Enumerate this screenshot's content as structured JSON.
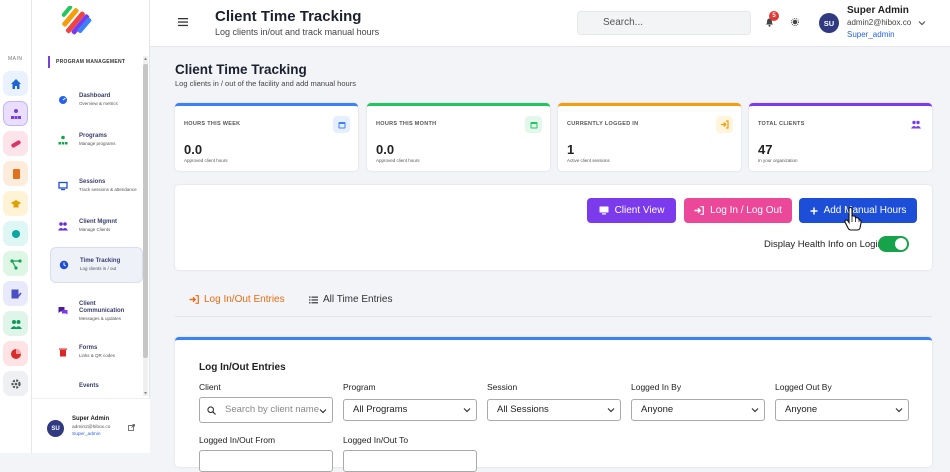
{
  "header": {
    "title": "Client Time Tracking",
    "subtitle": "Log clients in/out and track manual hours",
    "search_placeholder": "Search...",
    "notification_count": "5",
    "user_initials": "SU",
    "user_name": "Super Admin",
    "user_email": "admin2@hibox.co",
    "user_role": "Super_admin"
  },
  "rail": {
    "main_label": "MAIN",
    "icons": [
      "home-icon",
      "org-chart-icon",
      "pill-icon",
      "book-icon",
      "graduation-icon",
      "circle-icon",
      "flow-icon",
      "form-icon",
      "people-icon",
      "pie-chart-icon",
      "gear-icon"
    ]
  },
  "sidebar": {
    "section": "PROGRAM MANAGEMENT",
    "items": [
      {
        "title": "Dashboard",
        "sub": "Overview & metrics"
      },
      {
        "title": "Programs",
        "sub": "Manage programs"
      },
      {
        "title": "Sessions",
        "sub": "Track sessions & attendance"
      },
      {
        "title": "Client Mgmnt",
        "sub": "Manage Clients"
      },
      {
        "title": "Time Tracking",
        "sub": "Log clients in / out"
      },
      {
        "title": "Client Communication",
        "sub": "Messages & updates"
      },
      {
        "title": "Forms",
        "sub": "Links & QR codes"
      },
      {
        "title": "Events",
        "sub": ""
      }
    ],
    "footer": {
      "initials": "SU",
      "name": "Super Admin",
      "email": "admin2@hibox.co",
      "role": "Super_admin"
    }
  },
  "page": {
    "title": "Client Time Tracking",
    "subtitle": "Log clients in / out of the facility and add manual hours"
  },
  "stats": [
    {
      "label": "HOURS THIS WEEK",
      "value": "0.0",
      "sub": "Approved client hours",
      "color": "#3b82f6"
    },
    {
      "label": "HOURS THIS MONTH",
      "value": "0.0",
      "sub": "Approved client hours",
      "color": "#22c55e"
    },
    {
      "label": "CURRENTLY LOGGED IN",
      "value": "1",
      "sub": "Active client sessions",
      "color": "#f59e0b"
    },
    {
      "label": "TOTAL CLIENTS",
      "value": "47",
      "sub": "In your organization",
      "color": "#7c3aed"
    }
  ],
  "actions": {
    "client_view": "Client View",
    "log_in_out": "Log In / Log Out",
    "add_manual": "Add Manual Hours",
    "toggle_label": "Display Health Info on Login",
    "toggle_on": true
  },
  "tabs": [
    "Log In/Out Entries",
    "All Time Entries"
  ],
  "entries": {
    "title": "Log In/Out Entries",
    "client_label": "Client",
    "client_placeholder": "Search by client name...",
    "program_label": "Program",
    "program_value": "All Programs",
    "session_label": "Session",
    "session_value": "All Sessions",
    "logged_in_by_label": "Logged In By",
    "logged_in_by_value": "Anyone",
    "logged_out_by_label": "Logged Out By",
    "logged_out_by_value": "Anyone",
    "from_label": "Logged In/Out From",
    "to_label": "Logged In/Out To"
  },
  "colors": {
    "accent_purple": "#7c3aed",
    "pink": "#ec4899",
    "blue": "#1d4ed8",
    "toggle_green": "#16a34a"
  }
}
